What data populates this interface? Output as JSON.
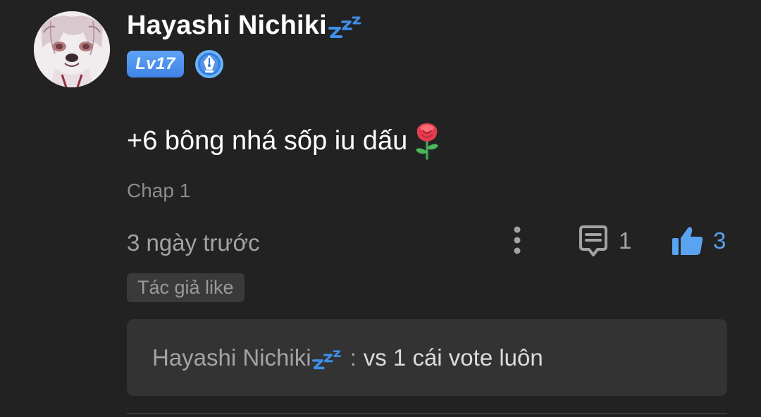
{
  "comment": {
    "username": "Hayashi Nichiki",
    "level_label": "Lv17",
    "text": "+6 bông nhá sốp iu dấu",
    "chapter": "Chap 1",
    "time": "3 ngày trước",
    "reply_count": "1",
    "like_count": "3",
    "author_like_label": "Tác giả like"
  },
  "reply_preview": {
    "username": "Hayashi Nichiki",
    "separator": ":",
    "message": "vs 1 cái vote luôn"
  },
  "icons": {
    "avatar": "user-avatar-icon",
    "sleep": "zzz-sleep-icon",
    "level_badge": "level-badge",
    "creator_badge": "pen-badge-icon",
    "emoji": "rose-emoji-icon",
    "more": "more-vertical-icon",
    "reply": "comment-bubble-icon",
    "like": "thumbs-up-icon"
  },
  "colors": {
    "background": "#222222",
    "accent": "#4a90e2",
    "like_active": "#5aa3f0",
    "muted_text": "#a3a3a3",
    "chip_background": "#3a3a3a",
    "reply_background": "#333333"
  }
}
